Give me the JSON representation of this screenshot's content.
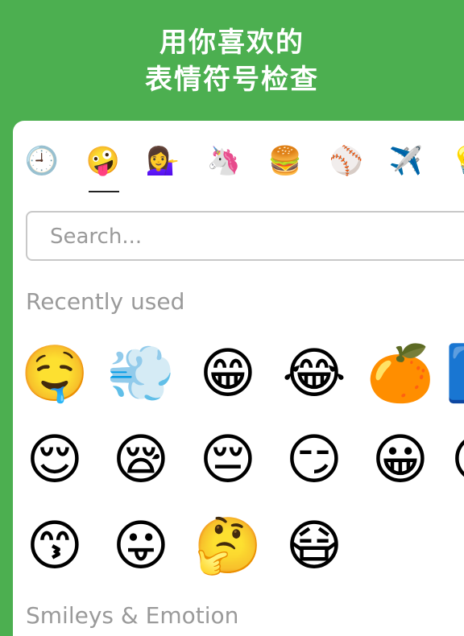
{
  "header": {
    "title_line1": "用你喜欢的",
    "title_line2": "表情符号检查"
  },
  "categories": [
    {
      "name": "recent",
      "glyph": "🕘"
    },
    {
      "name": "smileys",
      "glyph": "🤪"
    },
    {
      "name": "people",
      "glyph": "💁‍♀️"
    },
    {
      "name": "animals",
      "glyph": "🦄"
    },
    {
      "name": "food",
      "glyph": "🍔"
    },
    {
      "name": "activity",
      "glyph": "⚾"
    },
    {
      "name": "travel",
      "glyph": "✈️"
    },
    {
      "name": "objects",
      "glyph": "💡"
    }
  ],
  "search": {
    "placeholder": "Search..."
  },
  "recently_used": {
    "title": "Recently used",
    "rows": [
      [
        "🤤",
        "💨",
        "😁",
        "😂",
        "🍊",
        "🟦"
      ],
      [
        "😌",
        "😪",
        "😔",
        "😏",
        "😀",
        "😊"
      ],
      [
        "😙",
        "😛",
        "🤔",
        "😷"
      ]
    ]
  },
  "smileys_section": {
    "title": "Smileys & Emotion"
  }
}
